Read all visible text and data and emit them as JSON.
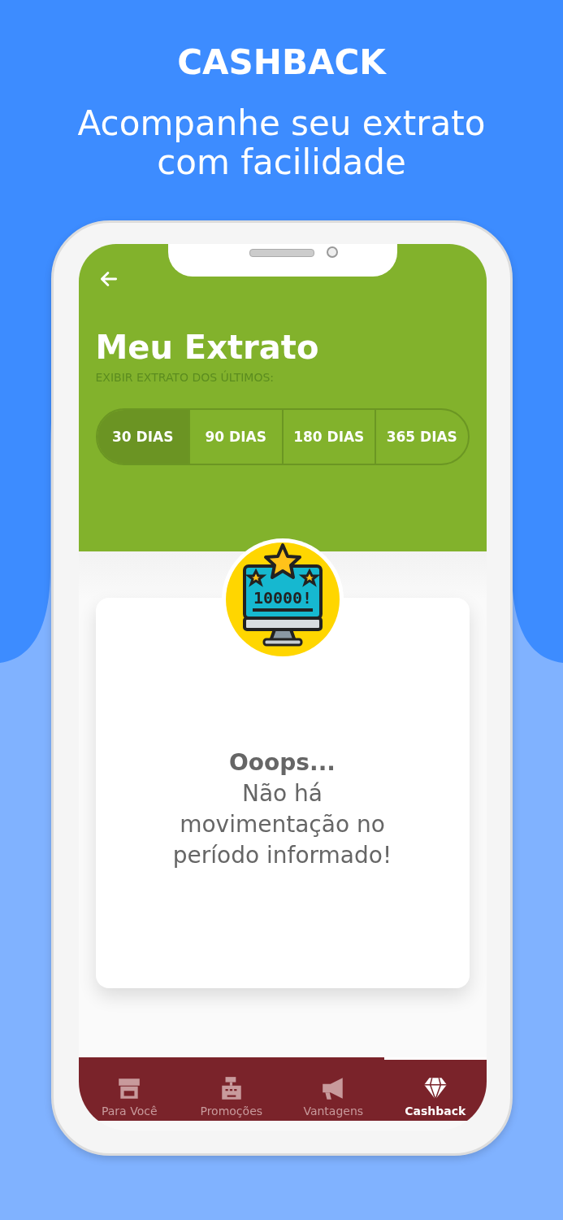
{
  "banner": {
    "title": "CASHBACK",
    "subtitle": "Acompanhe seu extrato com facilidade"
  },
  "screen": {
    "title": "Meu Extrato",
    "filter_label": "EXIBIR EXTRATO DOS ÚLTIMOS:",
    "periods": [
      {
        "label": "30 DIAS",
        "selected": true
      },
      {
        "label": "90 DIAS",
        "selected": false
      },
      {
        "label": "180 DIAS",
        "selected": false
      },
      {
        "label": "365 DIAS",
        "selected": false
      }
    ],
    "badge_text": "10000!",
    "empty_state": {
      "title": "Ooops...",
      "message": "Não há movimentação no período informado!"
    },
    "nav": [
      {
        "label": "Para Você",
        "selected": false
      },
      {
        "label": "Promoções",
        "selected": false
      },
      {
        "label": "Vantagens",
        "selected": false
      },
      {
        "label": "Cashback",
        "selected": true
      }
    ]
  }
}
